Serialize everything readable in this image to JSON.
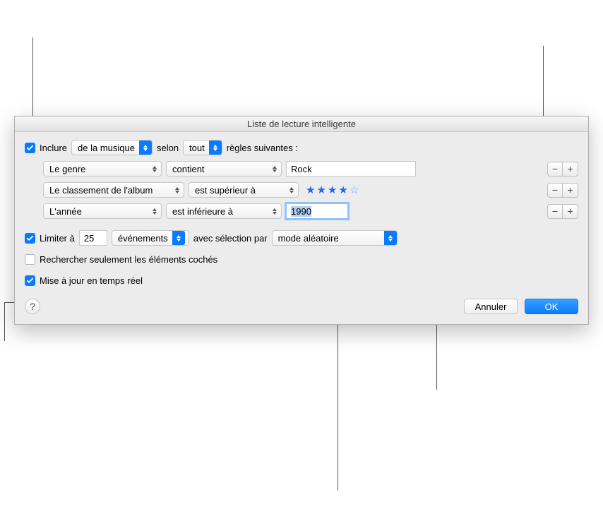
{
  "title": "Liste de lecture intelligente",
  "match": {
    "include_label": "Inclure",
    "source": "de la musique",
    "by_label": "selon",
    "mode": "tout",
    "suffix": "règles suivantes :",
    "checked": true
  },
  "rules": [
    {
      "field": "Le genre",
      "operator": "contient",
      "value_type": "text",
      "value": "Rock"
    },
    {
      "field": "Le classement de l'album",
      "operator": "est supérieur à",
      "value_type": "stars",
      "stars": 4
    },
    {
      "field": "L'année",
      "operator": "est inférieure à",
      "value_type": "text",
      "value": "1990",
      "focused": true,
      "selected": true
    }
  ],
  "limit": {
    "checked": true,
    "label": "Limiter à",
    "count": "25",
    "unit": "événements",
    "with_label": "avec sélection par",
    "mode": "mode aléatoire"
  },
  "checked_only": {
    "checked": false,
    "label": "Rechercher seulement les éléments cochés"
  },
  "live": {
    "checked": true,
    "label": "Mise à jour en temps réel"
  },
  "help_symbol": "?",
  "buttons": {
    "cancel": "Annuler",
    "ok": "OK"
  },
  "icons": {
    "minus": "−",
    "plus": "+"
  }
}
